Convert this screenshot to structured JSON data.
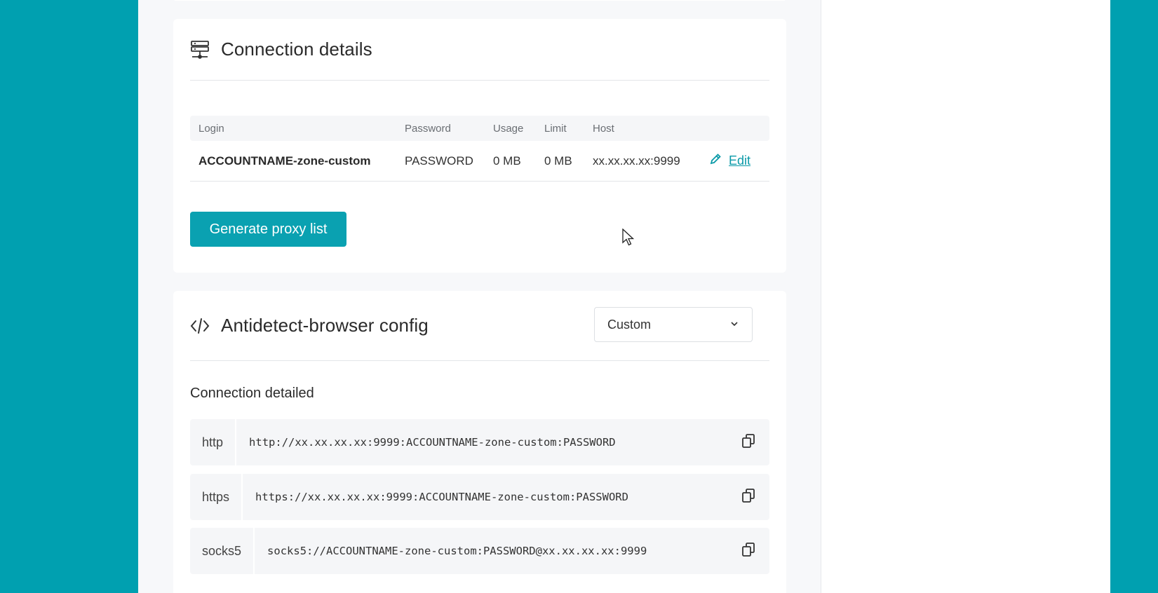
{
  "connection_card": {
    "title": "Connection details",
    "icon": "server-icon",
    "table": {
      "headers": [
        "Login",
        "Password",
        "Usage",
        "Limit",
        "Host"
      ],
      "row": {
        "login": "ACCOUNTNAME-zone-custom",
        "password": "PASSWORD",
        "usage": "0 MB",
        "limit": "0 MB",
        "host": "xx.xx.xx.xx:9999",
        "edit_label": "Edit"
      }
    },
    "generate_button": "Generate proxy list"
  },
  "antidetect_card": {
    "title": "Antidetect-browser config",
    "icon": "code-icon",
    "select_value": "Custom",
    "subheading": "Connection detailed",
    "connections": [
      {
        "protocol": "http",
        "value": "http://xx.xx.xx.xx:9999:ACCOUNTNAME-zone-custom:PASSWORD"
      },
      {
        "protocol": "https",
        "value": "https://xx.xx.xx.xx:9999:ACCOUNTNAME-zone-custom:PASSWORD"
      },
      {
        "protocol": "socks5",
        "value": "socks5://ACCOUNTNAME-zone-custom:PASSWORD@xx.xx.xx.xx:9999"
      }
    ]
  },
  "colors": {
    "accent": "#0aa1b1",
    "background": "#00a0b0",
    "panel": "#f7f8fa"
  }
}
